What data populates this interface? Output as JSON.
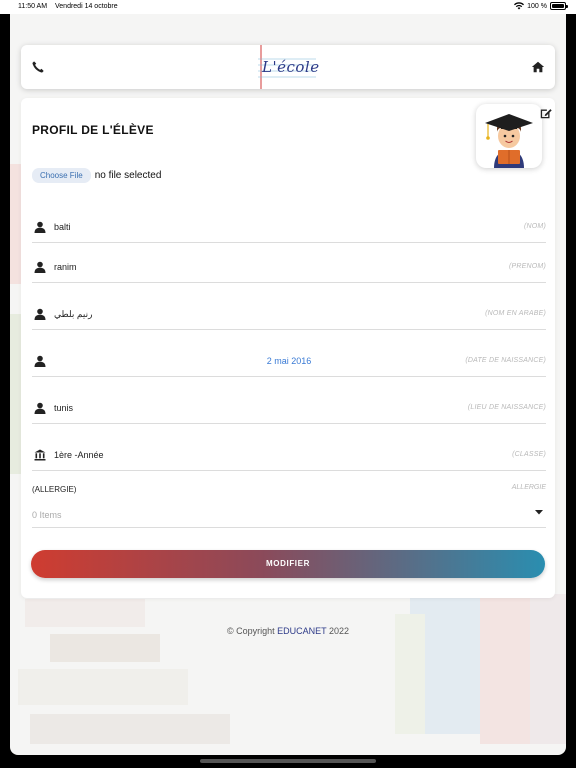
{
  "status": {
    "time": "11:50 AM",
    "date": "Vendredi 14 octobre",
    "battery": "100 %"
  },
  "header": {
    "logo_text": "L'école",
    "phone_icon": "phone-icon",
    "home_icon": "home-icon"
  },
  "profile": {
    "title": "PROFIL DE L'ÉLÈVE",
    "file_button": "Choose File",
    "file_status": "no file selected",
    "avatar_icon": "student-avatar-icon",
    "edit_icon": "edit-icon"
  },
  "fields": [
    {
      "icon": "user-icon",
      "value": "balti",
      "placeholder": "(NOM)"
    },
    {
      "icon": "user-icon",
      "value": "ranim",
      "placeholder": "(PRENOM)"
    },
    {
      "icon": "user-icon",
      "value": "رنيم بلطي",
      "placeholder": "(NOM EN ARABE)"
    },
    {
      "icon": "user-icon",
      "value": "2 mai 2016",
      "placeholder": "(DATE DE NAISSANCE)"
    },
    {
      "icon": "user-icon",
      "value": "tunis",
      "placeholder": "(LIEU DE NAISSANCE)"
    },
    {
      "icon": "bank-icon",
      "value": "1ère -Année",
      "placeholder": "(CLASSE)"
    }
  ],
  "allergy": {
    "label": "(ALLERGIE)",
    "placeholder": "ALLERGIE",
    "count": "0 Items"
  },
  "button": {
    "label": "MODIFIER"
  },
  "footer": {
    "prefix": "© Copyright",
    "brand": "EDUCANET",
    "year": "2022"
  },
  "colors": {
    "accent_blue": "#3a7bd5",
    "gradient_start": "#cf3c30",
    "gradient_end": "#2a8eb0",
    "brand": "#2d3a88"
  }
}
